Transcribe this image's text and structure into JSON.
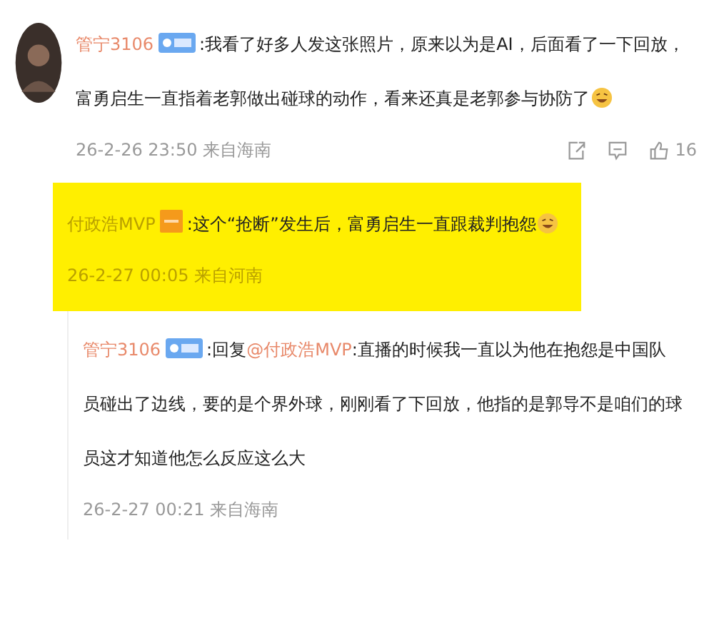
{
  "comment": {
    "user": "管宁3106",
    "badge": {
      "kind": "fan"
    },
    "text": ":我看了好多人发这张照片，原来以为是AI，后面看了一下回放，富勇启生一直指着老郭做出碰球的动作，看来还真是老郭参与协防了",
    "emoji": true,
    "time": "26-2-26 23:50",
    "location": "来自海南",
    "like_count": "16"
  },
  "replies": [
    {
      "user": "付政浩MVP",
      "badge": {
        "kind": "author"
      },
      "highlighted": true,
      "text": ":这个“抢断”发生后，富勇启生一直跟裁判抱怨",
      "emoji": true,
      "time": "26-2-27 00:05",
      "location": "来自河南"
    },
    {
      "user": "管宁3106",
      "badge": {
        "kind": "fan"
      },
      "highlighted": false,
      "prefix": ":回复",
      "mention": "@付政浩MVP",
      "text": ":直播的时候我一直以为他在抱怨是中国队员碰出了边线，要的是个界外球，刚刚看了下回放，他指的是郭导不是咱们的球员这才知道他怎么反应这么大",
      "emoji": false,
      "time": "26-2-27 00:21",
      "location": "来自海南"
    }
  ]
}
